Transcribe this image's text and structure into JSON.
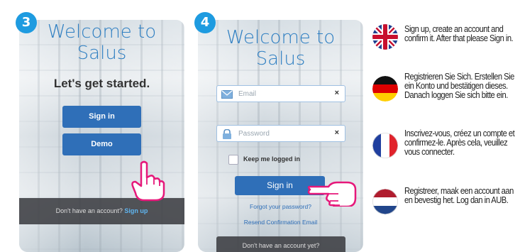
{
  "steps": [
    {
      "number": "3"
    },
    {
      "number": "4"
    }
  ],
  "screen3": {
    "title_line1": "Welcome to",
    "title_line2": "Salus",
    "subtitle": "Let's get started.",
    "signin_label": "Sign in",
    "demo_label": "Demo",
    "no_account_text": "Don't have an account?",
    "signup_link": "Sign up"
  },
  "screen4": {
    "title_line1": "Welcome to",
    "title_line2": "Salus",
    "email_placeholder": "Email",
    "password_placeholder": "Password",
    "clear_icon": "×",
    "keep_logged_in": "Keep me logged in",
    "signin_label": "Sign in",
    "forgot_password": "Forgot your password?",
    "resend_email": "Resend Confirmation Email",
    "no_account_text": "Don't have an account yet?"
  },
  "instructions": [
    {
      "lang": "en",
      "flag_icon": "uk-flag-icon",
      "text": "Sign up, create an account and confirm it. After that please Sign in."
    },
    {
      "lang": "de",
      "flag_icon": "germany-flag-icon",
      "text": "Registrieren Sie Sich. Erstellen Sie ein Konto und bestätigen dieses. Danach loggen Sie sich bitte ein."
    },
    {
      "lang": "fr",
      "flag_icon": "france-flag-icon",
      "text": "Inscrivez-vous, créez un compte et confirmez-le. Après cela, veuillez vous connecter."
    },
    {
      "lang": "nl",
      "flag_icon": "netherlands-flag-icon",
      "text": "Registreer, maak een account aan en bevestig het. Log dan in AUB."
    }
  ],
  "colors": {
    "badge": "#1e9be0",
    "title": "#2f7fc2",
    "button": "#2f6fb8",
    "link": "#5fb5f0"
  }
}
